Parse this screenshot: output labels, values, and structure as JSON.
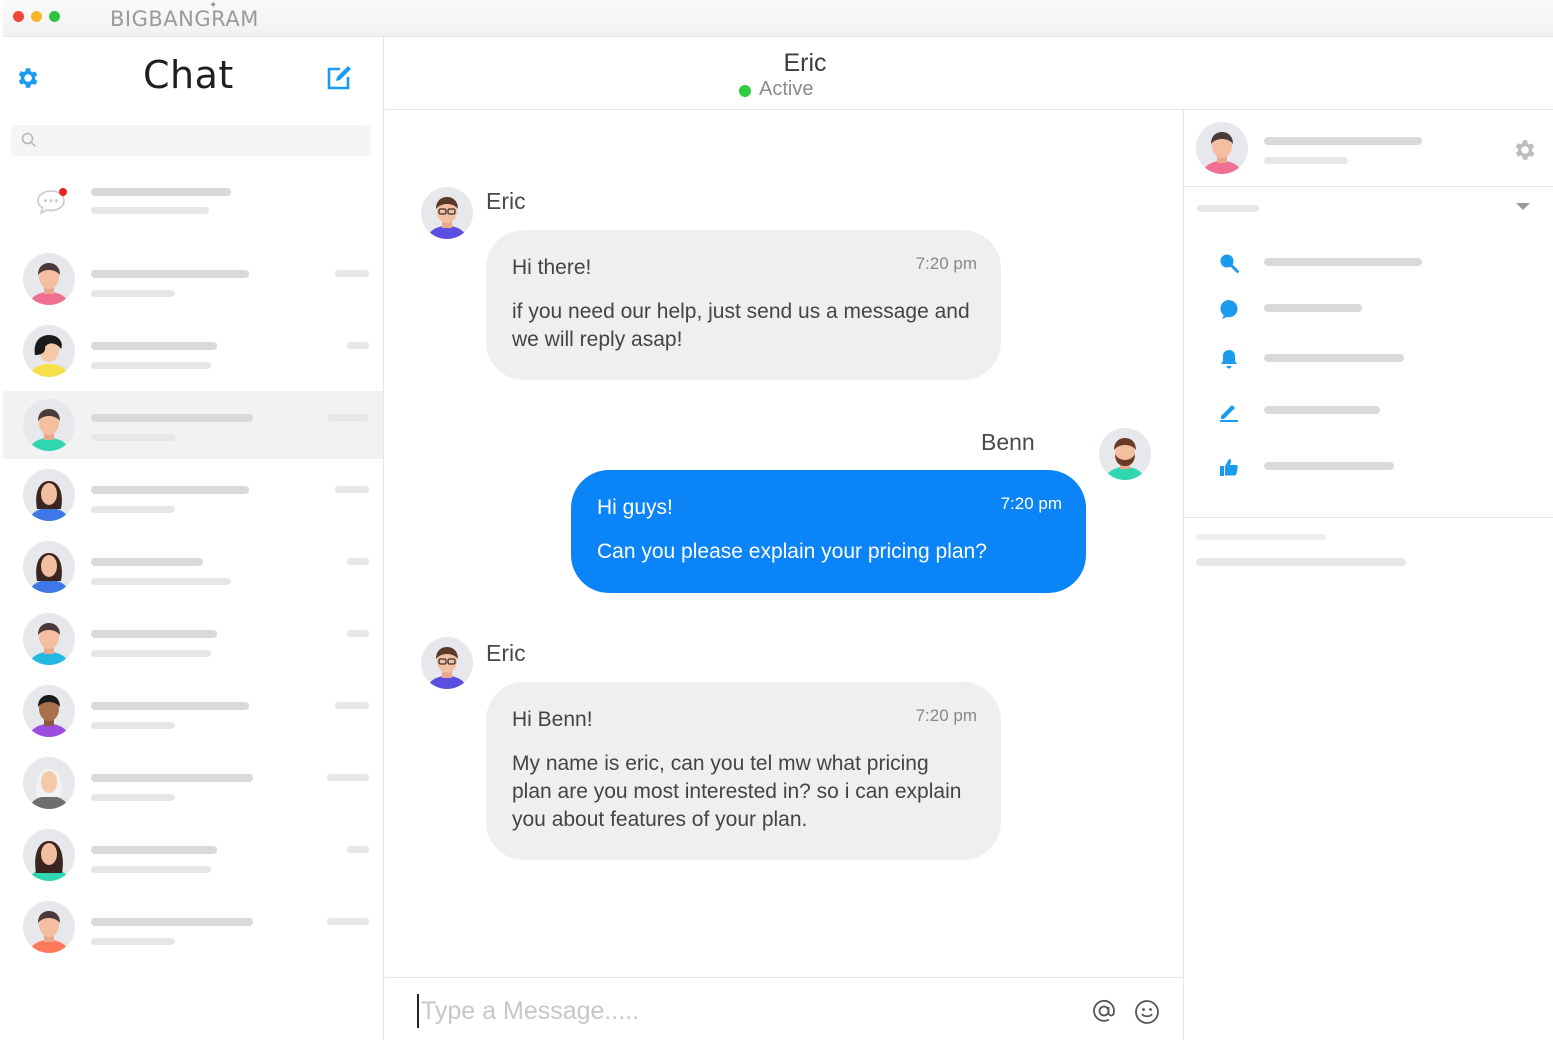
{
  "app": {
    "brand": "BIGBANGRAM"
  },
  "sidebar": {
    "title": "Chat",
    "search_placeholder": "",
    "conversation_count": 10
  },
  "header": {
    "contact_name": "Eric",
    "status": "Active",
    "status_color": "#2ecc40"
  },
  "messages": [
    {
      "sender": "Eric",
      "side": "left",
      "greeting": "Hi there!",
      "time": "7:20 pm",
      "text": "if you need our help, just send us a message and we will reply asap!"
    },
    {
      "sender": "Benn",
      "side": "right",
      "greeting": "Hi guys!",
      "time": "7:20 pm",
      "text": "Can you please explain your pricing plan?"
    },
    {
      "sender": "Eric",
      "side": "left",
      "greeting": "Hi Benn!",
      "time": "7:20 pm",
      "text": "My name is eric, can you tel mw what pricing plan are you most interested in? so i can explain you about features of your plan."
    }
  ],
  "composer": {
    "placeholder": "Type a Message....."
  },
  "right_panel": {
    "menu_icons": [
      "search-icon",
      "chat-bubble-icon",
      "bell-icon",
      "pencil-icon",
      "thumbs-up-icon"
    ]
  },
  "colors": {
    "accent": "#0a84f6",
    "bubble_gray": "#efefef",
    "placeholder_bar": "#d9d9d9"
  }
}
